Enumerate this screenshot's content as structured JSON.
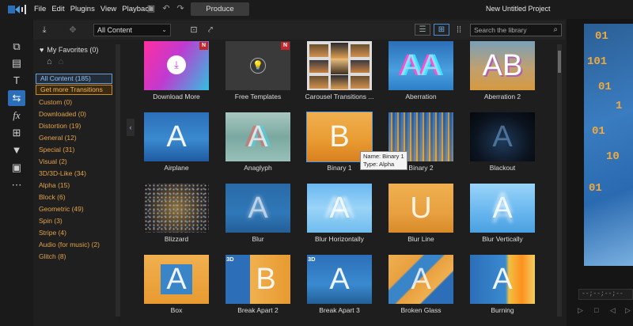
{
  "menubar": {
    "items": [
      "File",
      "Edit",
      "Plugins",
      "View",
      "Playback"
    ],
    "produce_label": "Produce",
    "project_title": "New Untitled Project"
  },
  "library": {
    "filter_value": "All Content",
    "search_placeholder": "Search the library"
  },
  "sidebar": {
    "favorites_label": "My Favorites (0)",
    "selected": "All Content (185)",
    "get_more": "Get more Transitions",
    "categories": [
      "Custom  (0)",
      "Downloaded  (0)",
      "Distortion  (19)",
      "General  (12)",
      "Special  (31)",
      "Visual  (2)",
      "3D/3D-Like  (34)",
      "Alpha  (15)",
      "Block  (6)",
      "Geometric  (49)",
      "Spin  (3)",
      "Stripe  (4)",
      "Audio (for music)  (2)",
      "Glitch  (8)"
    ]
  },
  "tiles": [
    "Download More",
    "Free Templates",
    "Carousel Transitions ...",
    "Aberration",
    "Aberration 2",
    "Airplane",
    "Anaglyph",
    "Binary 1",
    "Binary 2",
    "Blackout",
    "Blizzard",
    "Blur",
    "Blur Horizontally",
    "Blur Line",
    "Blur Vertically",
    "Box",
    "Break Apart 2",
    "Break Apart 3",
    "Broken Glass",
    "Burning"
  ],
  "badges": {
    "new": "N",
    "three_d": "3D"
  },
  "tile_glyphs": {
    "aberration": "AA",
    "aberration2": "AB",
    "a": "A",
    "b": "B",
    "u": "U"
  },
  "tooltip": {
    "name": "Name: Binary 1",
    "type": "Type: Alpha"
  },
  "preview": {
    "timecode": "--;--;--;--",
    "binary_rows": [
      "01",
      "101",
      "01",
      "1",
      "01",
      "10",
      "01"
    ]
  },
  "colors": {
    "accent_blue": "#2c6fb8",
    "category_orange": "#e2a24a",
    "new_badge_red": "#c0282b",
    "background": "#1e1e1e"
  }
}
